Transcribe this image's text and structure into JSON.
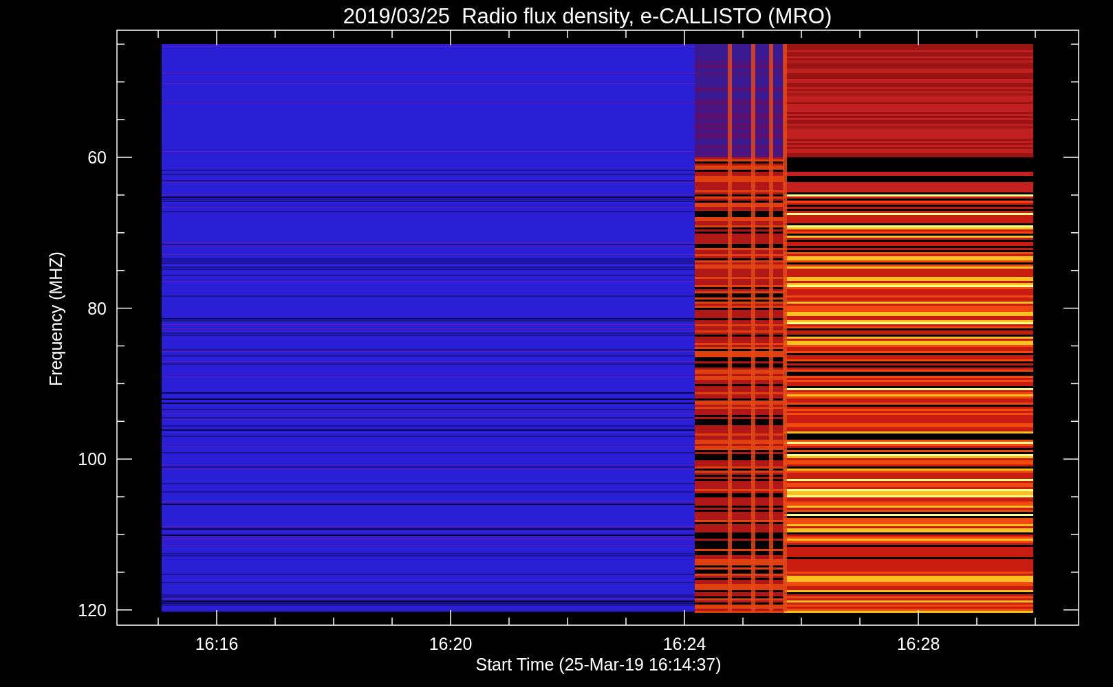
{
  "title": "2019/03/25  Radio flux density, e-CALLISTO (MRO)",
  "spectrogram": {
    "ylabel": "Frequency (MHZ)",
    "xlabel": "Start Time (25-Mar-19 16:14:37)",
    "yticks": [
      "60",
      "80",
      "100",
      "120"
    ],
    "xticks": [
      "16:16",
      "16:20",
      "16:24",
      "16:28"
    ]
  }
}
